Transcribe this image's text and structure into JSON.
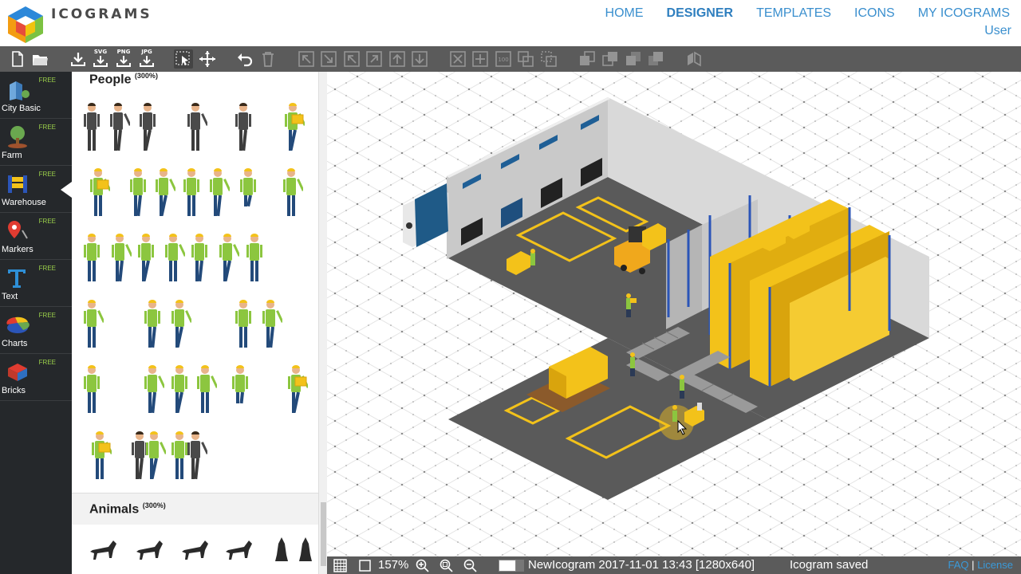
{
  "brand": {
    "name": "ICOGRAMS"
  },
  "nav": {
    "items": [
      "HOME",
      "DESIGNER",
      "TEMPLATES",
      "ICONS",
      "MY ICOGRAMS"
    ],
    "active": "DESIGNER",
    "user": "User"
  },
  "toolbar": {
    "export_labels": {
      "svg": "SVG",
      "png": "PNG",
      "jpg": "JPG"
    }
  },
  "categories": [
    {
      "label": "City Basic",
      "badge": "FREE",
      "icon": "city-icon"
    },
    {
      "label": "Farm",
      "badge": "FREE",
      "icon": "farm-icon"
    },
    {
      "label": "Warehouse",
      "badge": "FREE",
      "icon": "warehouse-icon"
    },
    {
      "label": "Markers",
      "badge": "FREE",
      "icon": "marker-icon"
    },
    {
      "label": "Text",
      "badge": "FREE",
      "icon": "text-icon"
    },
    {
      "label": "Charts",
      "badge": "FREE",
      "icon": "chart-icon"
    },
    {
      "label": "Bricks",
      "badge": "FREE",
      "icon": "brick-icon"
    }
  ],
  "active_category": "Warehouse",
  "palette": {
    "people_title": "People",
    "people_tag": "(300%)",
    "animals_title": "Animals",
    "animals_tag": "(300%)"
  },
  "status": {
    "zoom": "157%",
    "document": "NewIcogram 2017-11-01 13:43 [1280x640]",
    "message": "Icogram saved",
    "faq": "FAQ",
    "separator": "|",
    "license": "License"
  },
  "colors": {
    "accent_blue": "#3a8fce",
    "toolbar_gray": "#5b5b5b",
    "sidebar_dark": "#25282b",
    "floor_gray": "#5a5a5a",
    "box_yellow": "#f3c21a",
    "rack_blue": "#2b55b8",
    "worker_green": "#8cc63f"
  }
}
